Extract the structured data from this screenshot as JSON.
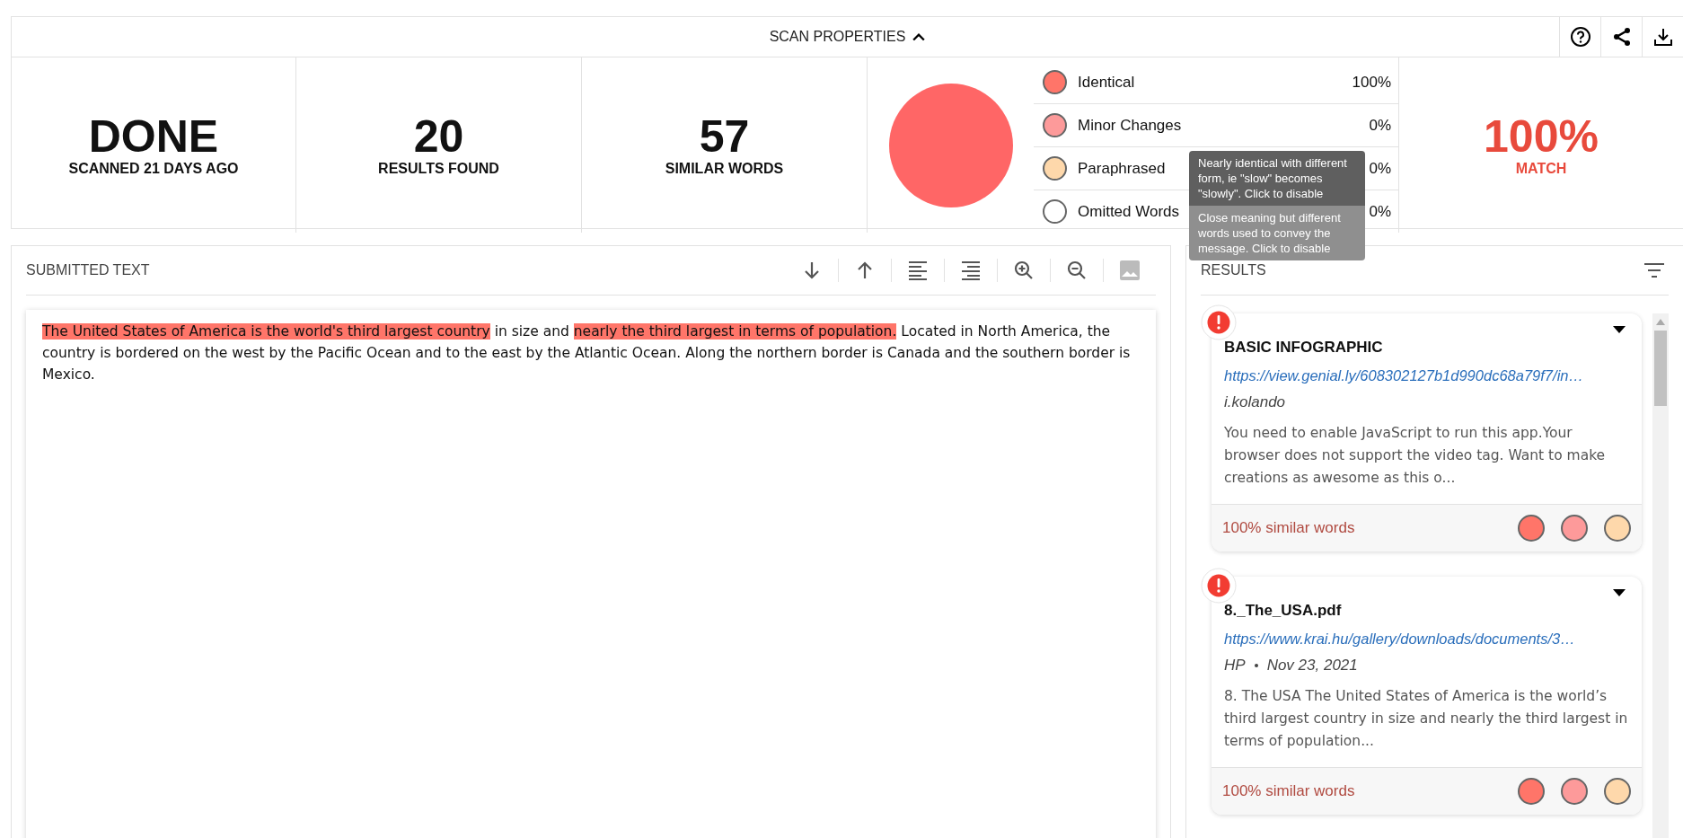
{
  "header": {
    "title": "SCAN PROPERTIES",
    "expanded": true
  },
  "actions": [
    {
      "kind": "help"
    },
    {
      "kind": "share"
    },
    {
      "kind": "download"
    }
  ],
  "stats": [
    {
      "value": "DONE",
      "label": "SCANNED 21 DAYS AGO"
    },
    {
      "value": "20",
      "label": "RESULTS FOUND"
    },
    {
      "value": "57",
      "label": "SIMILAR WORDS"
    }
  ],
  "legend": [
    {
      "label": "Identical",
      "percent": "100%",
      "color": "#ff7569"
    },
    {
      "label": "Minor Changes",
      "percent": "0%",
      "color": "#fd9a9a"
    },
    {
      "label": "Paraphrased",
      "percent": "0%",
      "color": "#fed8ab"
    },
    {
      "label": "Omitted Words",
      "percent": "0%",
      "color": "#ffffff"
    }
  ],
  "tooltips": [
    {
      "text": "Nearly identical with different form, ie \"slow\" becomes \"slowly\". Click to disable",
      "kind": "dark"
    },
    {
      "text": "Close meaning but different words used to convey the message. Click to disable",
      "kind": "faded"
    }
  ],
  "match": {
    "value": "100%",
    "label": "MATCH"
  },
  "submitted": {
    "title": "SUBMITTED TEXT",
    "toolbar": [
      {
        "kind": "down",
        "disabled": false
      },
      {
        "kind": "up",
        "disabled": false
      },
      {
        "kind": "align-left",
        "disabled": false
      },
      {
        "kind": "align-right",
        "disabled": false
      },
      {
        "kind": "zoom-in",
        "disabled": false
      },
      {
        "kind": "zoom-out",
        "disabled": false
      },
      {
        "kind": "image",
        "disabled": true
      }
    ],
    "segments": [
      {
        "text": "The United States of America is the world's third largest country",
        "highlighted": true
      },
      {
        "text": " in size and ",
        "highlighted": false
      },
      {
        "text": "nearly the third largest in terms of population.",
        "highlighted": true
      },
      {
        "text": " Located in North America, the country is bordered on the west by the Pacific Ocean and to the east by the Atlantic Ocean. Along the northern border is Canada and the southern border is Mexico.",
        "highlighted": false
      }
    ]
  },
  "results": {
    "title": "RESULTS",
    "items": [
      {
        "title": "BASIC INFOGRAPHIC",
        "url": "https://view.genial.ly/608302127b1d990dc68a79f7/in…",
        "author": "i.kolando",
        "snippet": "You need to enable JavaScript to run this app.Your browser does not support the video tag. Want to make creations as awesome as this o...",
        "similar": "100% similar words",
        "dots": [
          {
            "color": "#ff7569"
          },
          {
            "color": "#fd9a9a"
          },
          {
            "color": "#fed8ab"
          }
        ]
      },
      {
        "title": "8._The_USA.pdf",
        "url": "https://www.krai.hu/gallery/downloads/documents/3…",
        "author": "HP",
        "date": "Nov 23, 2021",
        "snippet": "8. The USA The United States of America is the world’s third largest country in size and nearly the third largest in terms of population...",
        "similar": "100% similar words",
        "dots": [
          {
            "color": "#ff7569"
          },
          {
            "color": "#fd9a9a"
          },
          {
            "color": "#fed8ab"
          }
        ]
      }
    ]
  }
}
